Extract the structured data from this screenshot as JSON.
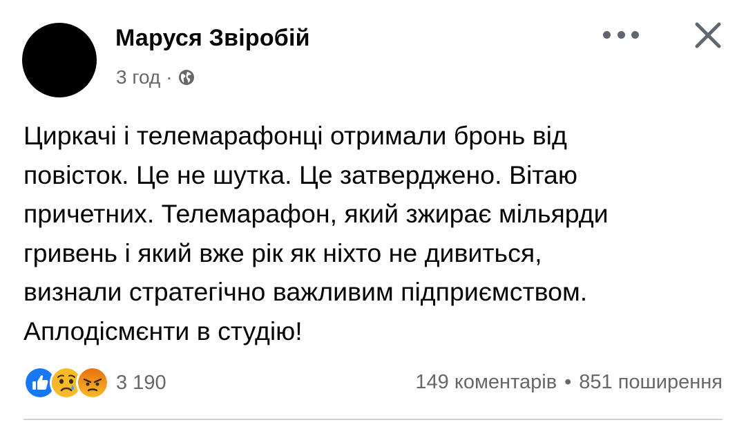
{
  "post": {
    "author": "Маруся Звіробій",
    "time": "3 год",
    "separator": "·",
    "privacy_icon": "globe-icon",
    "text": "Циркачі і телемарафонці отримали бронь від\nповісток. Це не шутка. Це затверджено. Вітаю\nпричетних. Телемарафон, який зжирає мільярди\nгривень і який вже рік як ніхто не дивиться,\nвизнали стратегічно важливим підприємством.\nАплодісмєнти в студію!"
  },
  "header_actions": {
    "more_icon": "more-horizontal-icon",
    "close_icon": "close-icon"
  },
  "reactions": {
    "icons": [
      "like-icon",
      "sad-icon",
      "angry-icon"
    ],
    "count": "3 190"
  },
  "engagement": {
    "comments": "149 коментарів",
    "separator": "•",
    "shares": "851 поширення"
  },
  "colors": {
    "like_blue": "#1877f2",
    "reaction_yellow": "#f7b928",
    "angry_orange": "#e9710f",
    "secondary_text": "#65676b"
  }
}
